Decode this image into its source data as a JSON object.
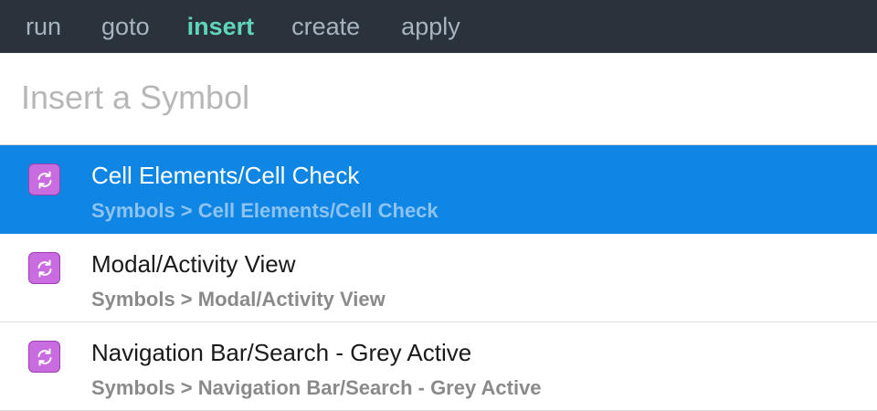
{
  "tabs": [
    {
      "label": "run",
      "active": false
    },
    {
      "label": "goto",
      "active": false
    },
    {
      "label": "insert",
      "active": true
    },
    {
      "label": "create",
      "active": false
    },
    {
      "label": "apply",
      "active": false
    }
  ],
  "search": {
    "placeholder": "Insert a Symbol",
    "value": ""
  },
  "results": [
    {
      "title": "Cell Elements/Cell Check",
      "path": "Symbols > Cell Elements/Cell Check",
      "icon": "symbol-sync-icon",
      "selected": true
    },
    {
      "title": "Modal/Activity View",
      "path": "Symbols > Modal/Activity View",
      "icon": "symbol-sync-icon",
      "selected": false
    },
    {
      "title": "Navigation Bar/Search - Grey Active",
      "path": "Symbols > Navigation Bar/Search - Grey Active",
      "icon": "symbol-sync-icon",
      "selected": false
    }
  ],
  "colors": {
    "tabbar_bg": "#2a333c",
    "tab_text": "#a7b3be",
    "tab_active": "#5fd6ba",
    "selection": "#0f86e3",
    "icon_fill": "#c96ce0"
  }
}
